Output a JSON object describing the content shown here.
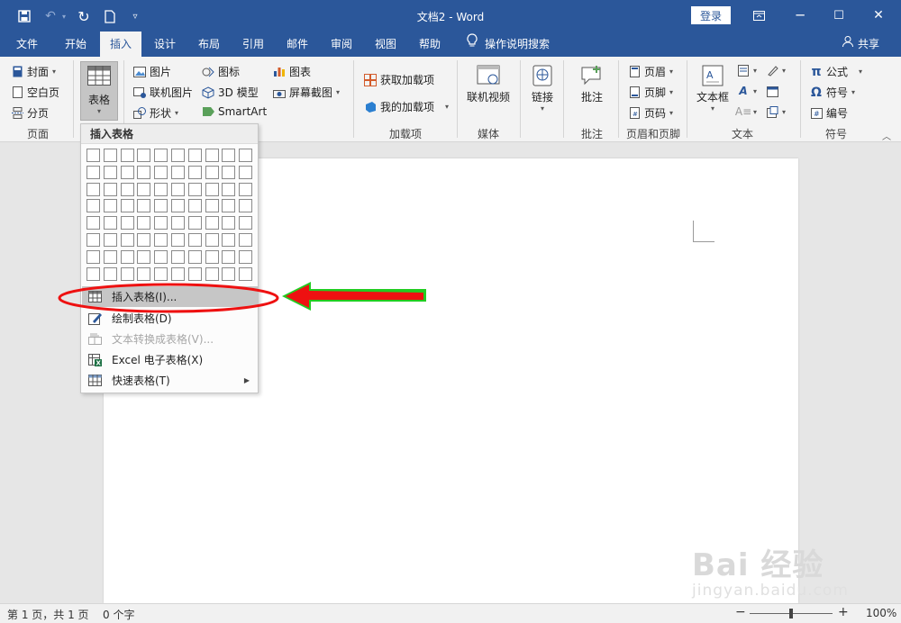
{
  "window": {
    "title": "文档2 - Word",
    "login_label": "登录",
    "controls": {
      "restore_icon": "ribbon-display-icon",
      "minimize": "─",
      "maximize": "☐",
      "close": "✕"
    }
  },
  "qat": {
    "save_icon": "save-icon",
    "undo_icon": "undo-icon",
    "redo_icon": "redo-icon",
    "new_icon": "new-document-icon",
    "customize_icon": "customize-qat-icon"
  },
  "tabs": [
    {
      "label": "文件"
    },
    {
      "label": "开始"
    },
    {
      "label": "插入",
      "active": true
    },
    {
      "label": "设计"
    },
    {
      "label": "布局"
    },
    {
      "label": "引用"
    },
    {
      "label": "邮件"
    },
    {
      "label": "审阅"
    },
    {
      "label": "视图"
    },
    {
      "label": "帮助"
    }
  ],
  "tellme": {
    "label": "操作说明搜索"
  },
  "share": {
    "label": "共享"
  },
  "ribbon": {
    "pages": {
      "cover": "封面",
      "blank": "空白页",
      "break": "分页",
      "group": "页面"
    },
    "table": {
      "label": "表格"
    },
    "illustrations": {
      "pictures": "图片",
      "online_pictures": "联机图片",
      "shapes": "形状",
      "icons": "图标",
      "model3d": "3D 模型",
      "smartart": "SmartArt",
      "chart": "图表",
      "screenshot": "屏幕截图"
    },
    "addins": {
      "get": "获取加载项",
      "mine": "我的加载项",
      "group": "加载项"
    },
    "media": {
      "video": "联机视频",
      "group": "媒体"
    },
    "links": {
      "link": "链接"
    },
    "comments": {
      "comment": "批注",
      "group": "批注"
    },
    "header_footer": {
      "header": "页眉",
      "footer": "页脚",
      "page_number": "页码",
      "group": "页眉和页脚"
    },
    "text": {
      "textbox": "文本框",
      "group": "文本"
    },
    "symbols": {
      "equation": "公式",
      "symbol": "符号",
      "number": "编号",
      "group": "符号"
    }
  },
  "dropdown": {
    "header": "插入表格",
    "grid": {
      "columns": 10,
      "rows": 8
    },
    "items": [
      {
        "label": "插入表格(I)...",
        "icon": "insert-table-icon",
        "highlighted": true
      },
      {
        "label": "绘制表格(D)",
        "icon": "draw-table-icon"
      },
      {
        "label": "文本转换成表格(V)...",
        "icon": "convert-text-icon",
        "disabled": true
      },
      {
        "label": "Excel 电子表格(X)",
        "icon": "excel-icon"
      },
      {
        "label": "快速表格(T)",
        "icon": "quick-tables-icon",
        "submenu": true
      }
    ]
  },
  "status": {
    "page": "第 1 页，共 1 页",
    "words": "0 个字",
    "zoom": "100%",
    "zoom_level": 1.0
  },
  "watermark": {
    "brand": "Bai 经验",
    "url": "jingyan.baidu.com"
  },
  "colors": {
    "accent": "#2b579a",
    "annotation_red": "#ee1111",
    "annotation_green": "#22cc22"
  }
}
